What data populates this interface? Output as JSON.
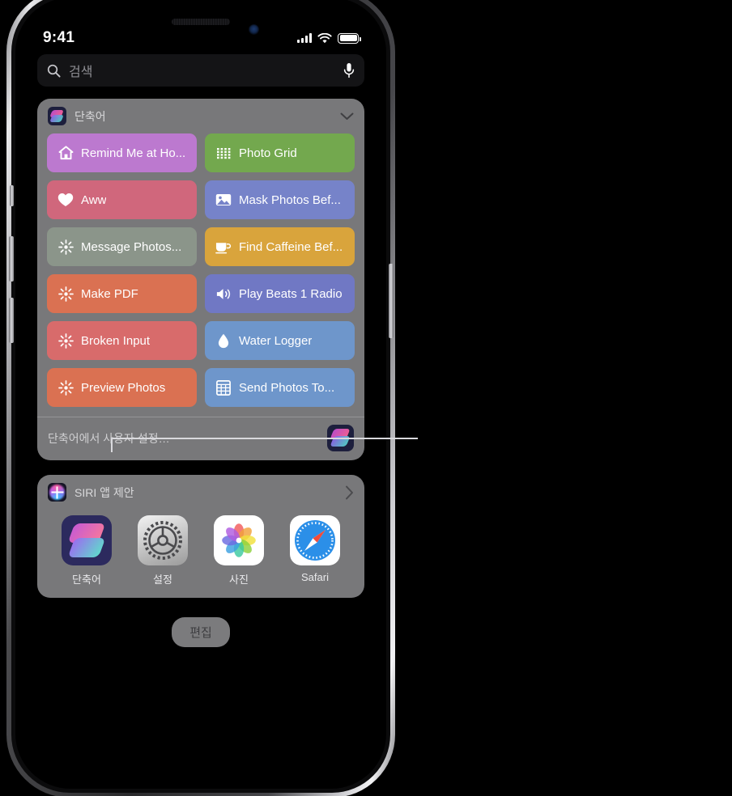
{
  "status_bar": {
    "time": "9:41",
    "cellular_icon": "signal-bars-icon",
    "wifi_icon": "wifi-icon",
    "battery_icon": "battery-icon"
  },
  "search": {
    "placeholder": "검색",
    "search_icon": "search-icon",
    "mic_icon": "microphone-icon"
  },
  "shortcuts_widget": {
    "title": "단축어",
    "app_icon": "shortcuts-app-icon",
    "collapse_icon": "chevron-down-icon",
    "footer_text": "단축어에서 사용자 설정…",
    "footer_icon": "shortcuts-app-icon",
    "tiles": [
      {
        "label": "Remind Me at Ho...",
        "icon": "house-icon",
        "color": "#bc79cf"
      },
      {
        "label": "Photo Grid",
        "icon": "dot-grid-icon",
        "color": "#73a84e"
      },
      {
        "label": "Aww",
        "icon": "heart-icon",
        "color": "#d0677c"
      },
      {
        "label": "Mask Photos Bef...",
        "icon": "photo-icon",
        "color": "#7683c9"
      },
      {
        "label": "Message Photos...",
        "icon": "sparkle-icon",
        "color": "#8b958a"
      },
      {
        "label": "Find Caffeine Bef...",
        "icon": "coffee-cup-icon",
        "color": "#d9a43c"
      },
      {
        "label": "Make PDF",
        "icon": "sparkle-icon",
        "color": "#da7152"
      },
      {
        "label": "Play Beats 1 Radio",
        "icon": "speaker-icon",
        "color": "#7078c4"
      },
      {
        "label": "Broken Input",
        "icon": "sparkle-icon",
        "color": "#d86b6b"
      },
      {
        "label": "Water Logger",
        "icon": "water-drop-icon",
        "color": "#6e96cb"
      },
      {
        "label": "Preview Photos",
        "icon": "sparkle-icon",
        "color": "#da7152"
      },
      {
        "label": "Send Photos To...",
        "icon": "table-grid-icon",
        "color": "#6e96cb"
      }
    ]
  },
  "siri_widget": {
    "title": "SIRI 앱 제안",
    "app_icon": "siri-icon",
    "disclosure_icon": "chevron-right-icon",
    "apps": [
      {
        "name": "단축어",
        "icon": "shortcuts-app-icon"
      },
      {
        "name": "설정",
        "icon": "settings-app-icon"
      },
      {
        "name": "사진",
        "icon": "photos-app-icon"
      },
      {
        "name": "Safari",
        "icon": "safari-app-icon"
      }
    ]
  },
  "edit_button": {
    "label": "편집"
  }
}
